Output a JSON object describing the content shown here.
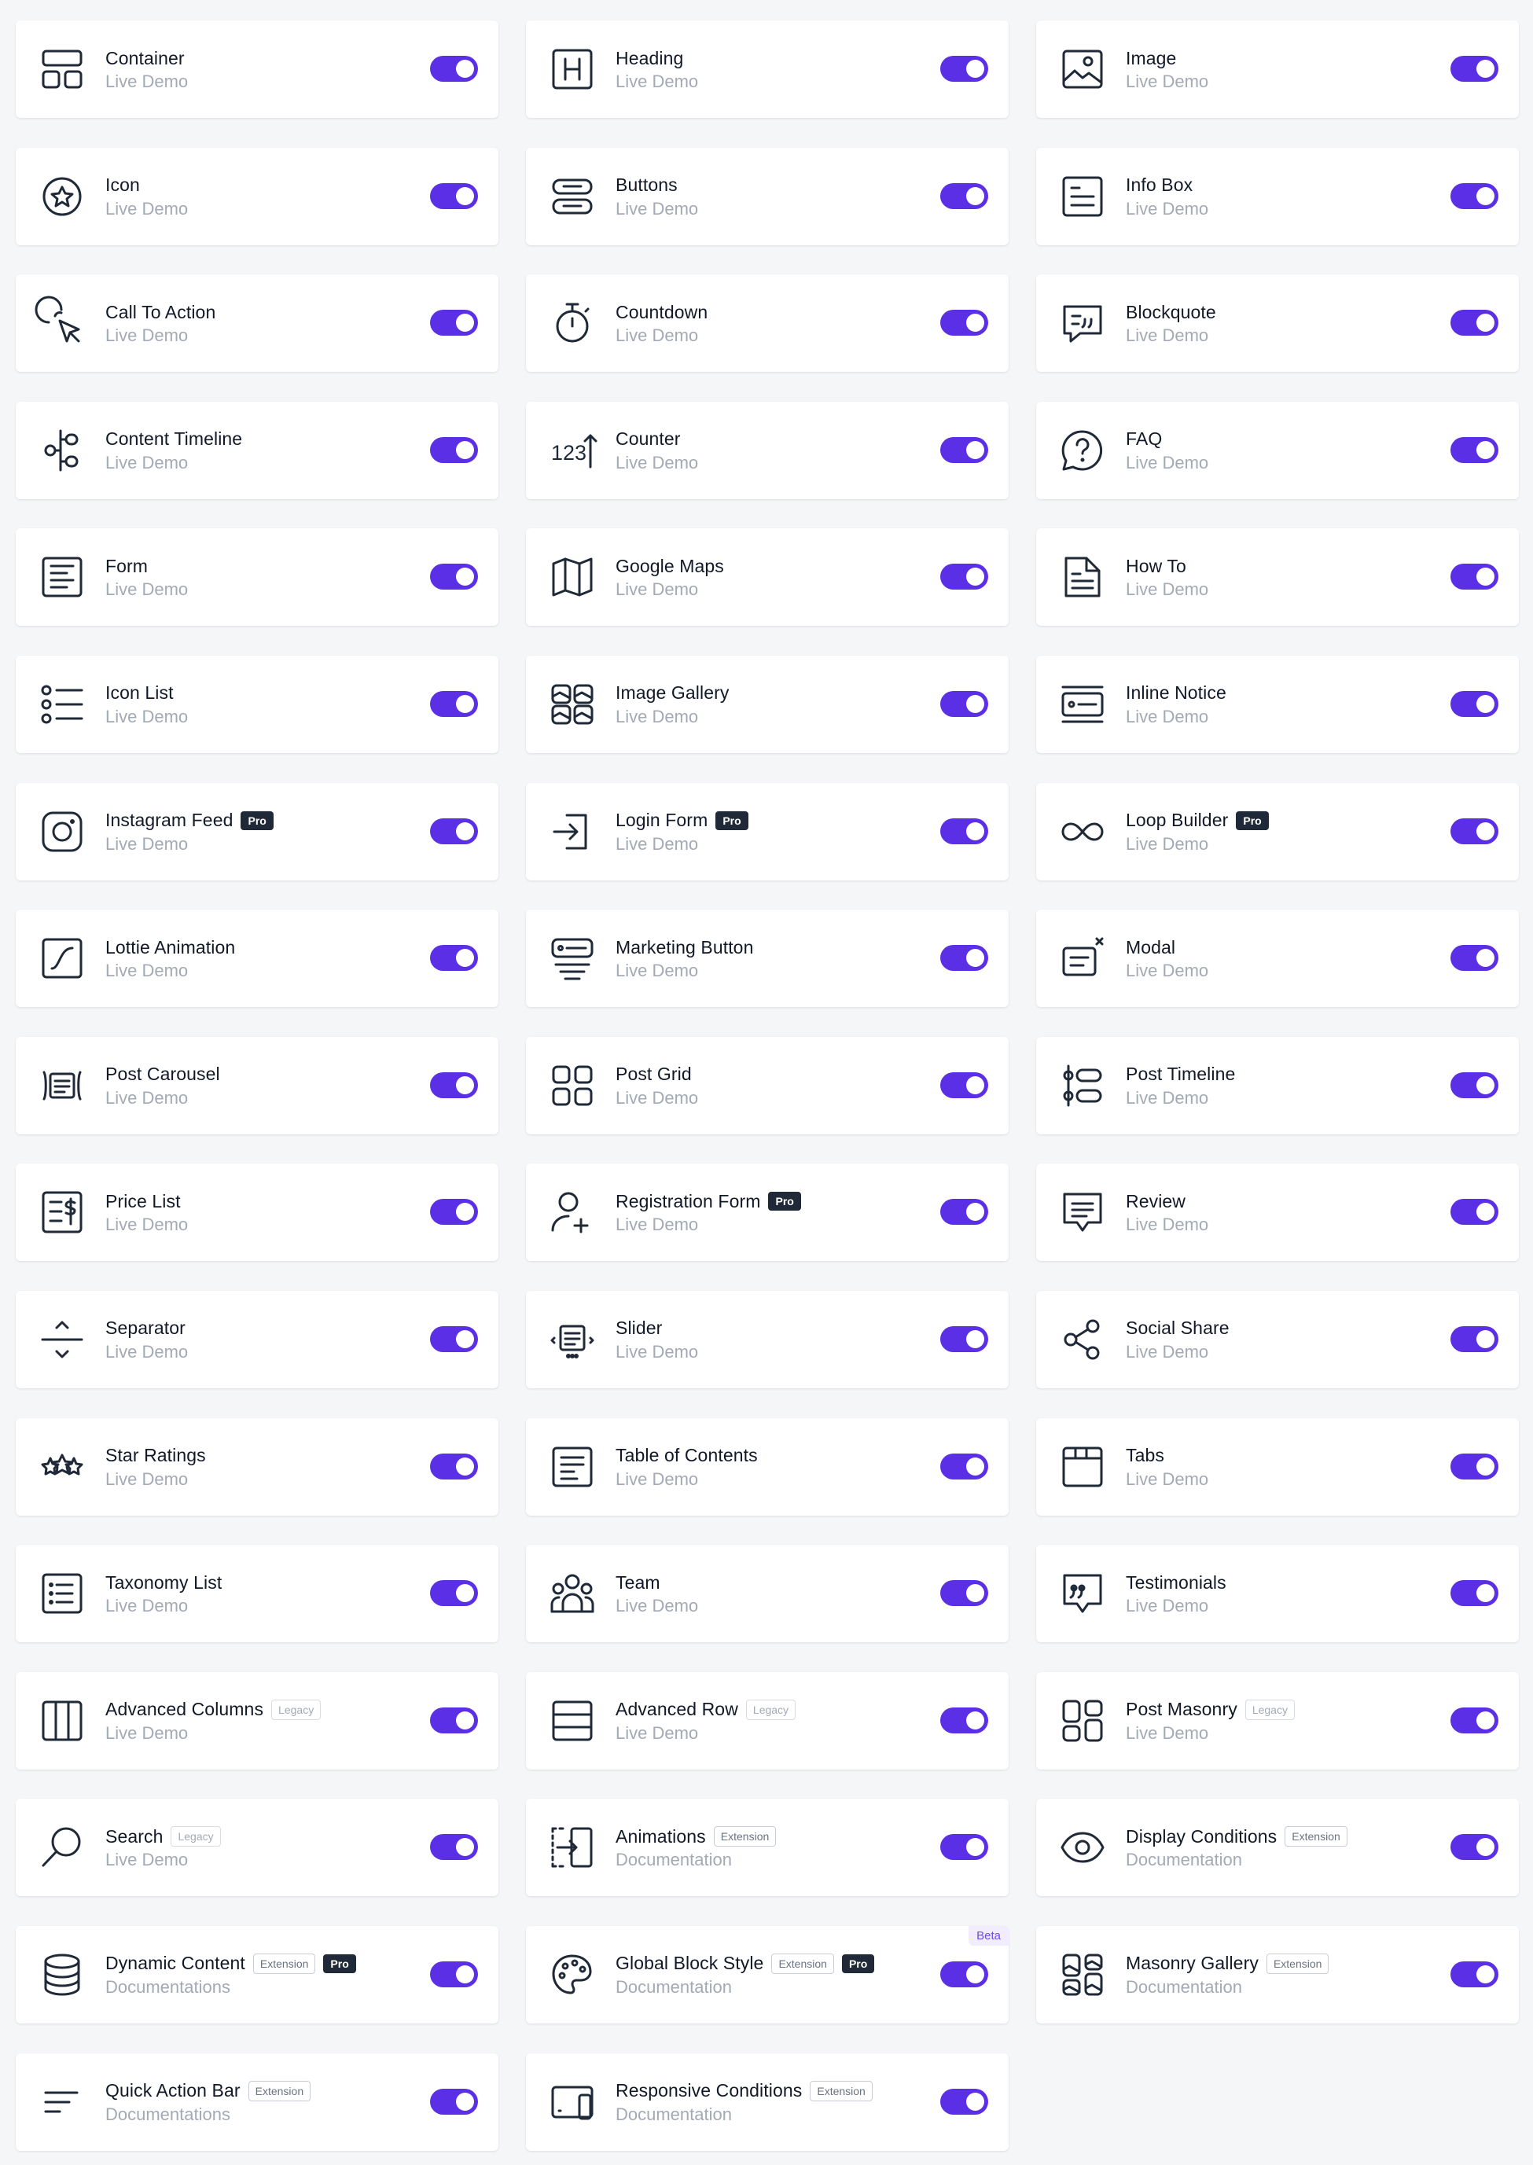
{
  "colors": {
    "accent": "#5b2fe6",
    "background": "#f5f6f8",
    "card": "#ffffff",
    "title": "#111827",
    "subtitle": "#a3a9b5",
    "pro_badge": "#1f2937"
  },
  "widgets": [
    {
      "title": "Container",
      "link": "Live Demo",
      "icon": "container-icon",
      "enabled": true
    },
    {
      "title": "Heading",
      "link": "Live Demo",
      "icon": "heading-icon",
      "enabled": true
    },
    {
      "title": "Image",
      "link": "Live Demo",
      "icon": "image-icon",
      "enabled": true
    },
    {
      "title": "Icon",
      "link": "Live Demo",
      "icon": "star-badge-icon",
      "enabled": true
    },
    {
      "title": "Buttons",
      "link": "Live Demo",
      "icon": "buttons-icon",
      "enabled": true
    },
    {
      "title": "Info Box",
      "link": "Live Demo",
      "icon": "info-box-icon",
      "enabled": true
    },
    {
      "title": "Call To Action",
      "link": "Live Demo",
      "icon": "cursor-click-icon",
      "enabled": true
    },
    {
      "title": "Countdown",
      "link": "Live Demo",
      "icon": "stopwatch-icon",
      "enabled": true
    },
    {
      "title": "Blockquote",
      "link": "Live Demo",
      "icon": "blockquote-icon",
      "enabled": true
    },
    {
      "title": "Content Timeline",
      "link": "Live Demo",
      "icon": "content-timeline-icon",
      "enabled": true
    },
    {
      "title": "Counter",
      "link": "Live Demo",
      "icon": "counter-icon",
      "icon_text": "123",
      "enabled": true
    },
    {
      "title": "FAQ",
      "link": "Live Demo",
      "icon": "question-bubble-icon",
      "enabled": true
    },
    {
      "title": "Form",
      "link": "Live Demo",
      "icon": "form-icon",
      "enabled": true
    },
    {
      "title": "Google Maps",
      "link": "Live Demo",
      "icon": "map-icon",
      "enabled": true
    },
    {
      "title": "How To",
      "link": "Live Demo",
      "icon": "how-to-icon",
      "enabled": true
    },
    {
      "title": "Icon List",
      "link": "Live Demo",
      "icon": "icon-list-icon",
      "enabled": true
    },
    {
      "title": "Image Gallery",
      "link": "Live Demo",
      "icon": "image-gallery-icon",
      "enabled": true
    },
    {
      "title": "Inline Notice",
      "link": "Live Demo",
      "icon": "inline-notice-icon",
      "enabled": true
    },
    {
      "title": "Instagram Feed",
      "link": "Live Demo",
      "icon": "instagram-icon",
      "badges": [
        {
          "type": "pro",
          "label": "Pro"
        }
      ],
      "enabled": true
    },
    {
      "title": "Login Form",
      "link": "Live Demo",
      "icon": "login-icon",
      "badges": [
        {
          "type": "pro",
          "label": "Pro"
        }
      ],
      "enabled": true
    },
    {
      "title": "Loop Builder",
      "link": "Live Demo",
      "icon": "infinity-icon",
      "badges": [
        {
          "type": "pro",
          "label": "Pro"
        }
      ],
      "enabled": true
    },
    {
      "title": "Lottie Animation",
      "link": "Live Demo",
      "icon": "lottie-icon",
      "enabled": true
    },
    {
      "title": "Marketing Button",
      "link": "Live Demo",
      "icon": "marketing-button-icon",
      "enabled": true
    },
    {
      "title": "Modal",
      "link": "Live Demo",
      "icon": "modal-icon",
      "enabled": true
    },
    {
      "title": "Post Carousel",
      "link": "Live Demo",
      "icon": "post-carousel-icon",
      "enabled": true
    },
    {
      "title": "Post Grid",
      "link": "Live Demo",
      "icon": "post-grid-icon",
      "enabled": true
    },
    {
      "title": "Post Timeline",
      "link": "Live Demo",
      "icon": "post-timeline-icon",
      "enabled": true
    },
    {
      "title": "Price List",
      "link": "Live Demo",
      "icon": "price-list-icon",
      "enabled": true
    },
    {
      "title": "Registration Form",
      "link": "Live Demo",
      "icon": "user-plus-icon",
      "badges": [
        {
          "type": "pro",
          "label": "Pro"
        }
      ],
      "enabled": true
    },
    {
      "title": "Review",
      "link": "Live Demo",
      "icon": "review-icon",
      "enabled": true
    },
    {
      "title": "Separator",
      "link": "Live Demo",
      "icon": "separator-icon",
      "enabled": true
    },
    {
      "title": "Slider",
      "link": "Live Demo",
      "icon": "slider-icon",
      "enabled": true
    },
    {
      "title": "Social Share",
      "link": "Live Demo",
      "icon": "share-icon",
      "enabled": true
    },
    {
      "title": "Star Ratings",
      "link": "Live Demo",
      "icon": "star-ratings-icon",
      "enabled": true
    },
    {
      "title": "Table of Contents",
      "link": "Live Demo",
      "icon": "table-of-contents-icon",
      "enabled": true
    },
    {
      "title": "Tabs",
      "link": "Live Demo",
      "icon": "tabs-icon",
      "enabled": true
    },
    {
      "title": "Taxonomy List",
      "link": "Live Demo",
      "icon": "taxonomy-list-icon",
      "enabled": true
    },
    {
      "title": "Team",
      "link": "Live Demo",
      "icon": "team-icon",
      "enabled": true
    },
    {
      "title": "Testimonials",
      "link": "Live Demo",
      "icon": "testimonials-icon",
      "enabled": true
    },
    {
      "title": "Advanced Columns",
      "link": "Live Demo",
      "icon": "columns-icon",
      "badges": [
        {
          "type": "legacy",
          "label": "Legacy"
        }
      ],
      "enabled": true
    },
    {
      "title": "Advanced Row",
      "link": "Live Demo",
      "icon": "rows-icon",
      "badges": [
        {
          "type": "legacy",
          "label": "Legacy"
        }
      ],
      "enabled": true
    },
    {
      "title": "Post Masonry",
      "link": "Live Demo",
      "icon": "masonry-icon",
      "badges": [
        {
          "type": "legacy",
          "label": "Legacy"
        }
      ],
      "enabled": true
    },
    {
      "title": "Search",
      "link": "Live Demo",
      "icon": "search-icon",
      "badges": [
        {
          "type": "legacy",
          "label": "Legacy"
        }
      ],
      "enabled": true
    },
    {
      "title": "Animations",
      "link": "Documentation",
      "icon": "animations-icon",
      "badges": [
        {
          "type": "outline",
          "label": "Extension"
        }
      ],
      "enabled": true
    },
    {
      "title": "Display Conditions",
      "link": "Documentation",
      "icon": "eye-icon",
      "badges": [
        {
          "type": "outline",
          "label": "Extension"
        }
      ],
      "enabled": true
    },
    {
      "title": "Dynamic Content",
      "link": "Documentations",
      "icon": "database-icon",
      "badges": [
        {
          "type": "outline",
          "label": "Extension"
        },
        {
          "type": "pro",
          "label": "Pro"
        }
      ],
      "enabled": true
    },
    {
      "title": "Global Block Style",
      "link": "Documentation",
      "icon": "palette-icon",
      "badges": [
        {
          "type": "outline",
          "label": "Extension"
        },
        {
          "type": "pro",
          "label": "Pro"
        }
      ],
      "corner": "Beta",
      "enabled": true
    },
    {
      "title": "Masonry Gallery",
      "link": "Documentation",
      "icon": "masonry-gallery-icon",
      "badges": [
        {
          "type": "outline",
          "label": "Extension"
        }
      ],
      "enabled": true
    },
    {
      "title": "Quick Action Bar",
      "link": "Documentations",
      "icon": "quick-action-bar-icon",
      "badges": [
        {
          "type": "outline",
          "label": "Extension"
        }
      ],
      "enabled": true
    },
    {
      "title": "Responsive Conditions",
      "link": "Documentation",
      "icon": "responsive-icon",
      "badges": [
        {
          "type": "outline",
          "label": "Extension"
        }
      ],
      "enabled": true
    }
  ]
}
